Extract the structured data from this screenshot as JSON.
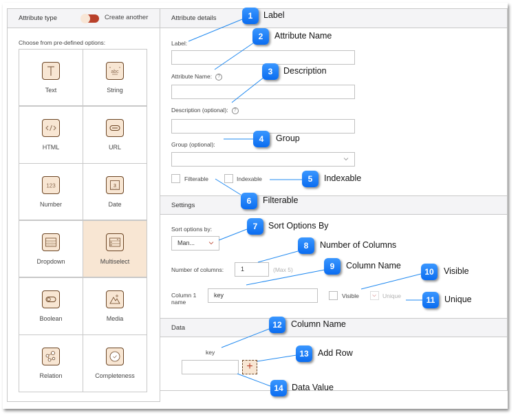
{
  "left_panel": {
    "header_title": "Attribute type",
    "toggle_label": "Create another",
    "toggle_on": true,
    "choose_label": "Choose from pre-defined options:",
    "types": [
      {
        "label": "Text",
        "icon": "text-icon",
        "selected": false
      },
      {
        "label": "String",
        "icon": "string-icon",
        "selected": false
      },
      {
        "label": "HTML",
        "icon": "html-icon",
        "selected": false
      },
      {
        "label": "URL",
        "icon": "url-icon",
        "selected": false
      },
      {
        "label": "Number",
        "icon": "number-icon",
        "selected": false
      },
      {
        "label": "Date",
        "icon": "date-icon",
        "selected": false
      },
      {
        "label": "Dropdown",
        "icon": "dropdown-icon",
        "selected": false
      },
      {
        "label": "Multiselect",
        "icon": "multiselect-icon",
        "selected": true
      },
      {
        "label": "Boolean",
        "icon": "boolean-icon",
        "selected": false
      },
      {
        "label": "Media",
        "icon": "media-icon",
        "selected": false
      },
      {
        "label": "Relation",
        "icon": "relation-icon",
        "selected": false
      },
      {
        "label": "Completeness",
        "icon": "completeness-icon",
        "selected": false
      }
    ]
  },
  "details": {
    "header_title": "Attribute details",
    "label_label": "Label:",
    "label_value": "",
    "name_label": "Attribute Name:",
    "name_value": "",
    "description_label": "Description (optional):",
    "description_value": "",
    "group_label": "Group (optional):",
    "group_value": "",
    "filterable_label": "Filterable",
    "filterable_checked": false,
    "indexable_label": "Indexable",
    "indexable_checked": false,
    "help_glyph": "?"
  },
  "settings": {
    "header_title": "Settings",
    "sort_label": "Sort options by:",
    "sort_value": "Man...",
    "columns_label": "Number of columns:",
    "columns_value": "1",
    "columns_max": "(Max 5)",
    "column1_label": "Column 1 name",
    "column1_value": "key",
    "visible_label": "Visible",
    "visible_checked": false,
    "unique_label": "Unique",
    "unique_checked": true
  },
  "data_section": {
    "header_title": "Data",
    "column_header": "key",
    "value": "",
    "add_row_glyph": "+"
  },
  "callouts": [
    {
      "num": "1",
      "text": "Label"
    },
    {
      "num": "2",
      "text": "Attribute Name"
    },
    {
      "num": "3",
      "text": "Description"
    },
    {
      "num": "4",
      "text": "Group"
    },
    {
      "num": "5",
      "text": "Indexable"
    },
    {
      "num": "6",
      "text": "Filterable"
    },
    {
      "num": "7",
      "text": "Sort Options By"
    },
    {
      "num": "8",
      "text": "Number of Columns"
    },
    {
      "num": "9",
      "text": "Column Name"
    },
    {
      "num": "10",
      "text": "Visible"
    },
    {
      "num": "11",
      "text": "Unique"
    },
    {
      "num": "12",
      "text": "Column Name"
    },
    {
      "num": "13",
      "text": "Add Row"
    },
    {
      "num": "14",
      "text": "Data Value"
    }
  ],
  "colors": {
    "accent": "#b8402a",
    "selected_bg": "#f8e6d3",
    "icon_border": "#6b4423",
    "callout_blue": "#0a6cf0",
    "header_bg": "#f4f4f6"
  }
}
